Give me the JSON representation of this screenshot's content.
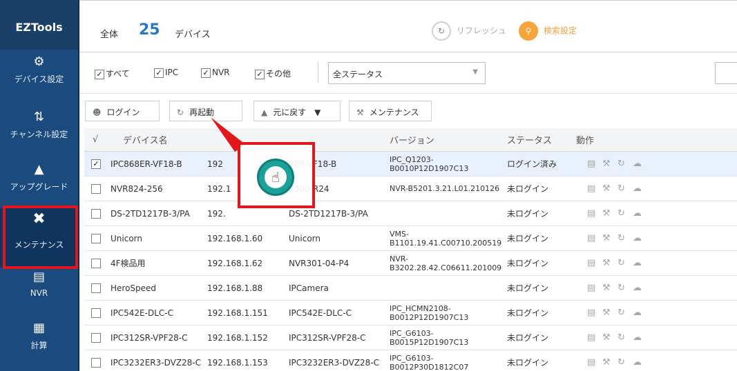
{
  "sidebar": {
    "logo": "EZTools",
    "items": [
      {
        "label": "デバイス設定",
        "icon": "gear-icon"
      },
      {
        "label": "チャンネル設定",
        "icon": "sliders-icon"
      },
      {
        "label": "アップグレード",
        "icon": "upgrade-icon"
      },
      {
        "label": "メンテナンス",
        "icon": "tools-icon"
      },
      {
        "label": "NVR",
        "icon": "nvr-icon"
      },
      {
        "label": "計算",
        "icon": "calculator-icon"
      }
    ]
  },
  "header": {
    "total_label": "全体",
    "total_count": "25",
    "total_unit": "デバイス",
    "refresh_label": "リフレッシュ",
    "search_settings_label": "検索設定"
  },
  "filters": {
    "all": "すべて",
    "ipc": "IPC",
    "nvr": "NVR",
    "other": "その他",
    "status_value": "全ステータス"
  },
  "toolbar": {
    "login": "ログイン",
    "reboot": "再起動",
    "restore": "元に戻す",
    "maintenance": "メンテナンス"
  },
  "table": {
    "headers": {
      "check": "√",
      "name": "デバイス名",
      "version": "バージョン",
      "status": "ステータス",
      "action": "動作"
    },
    "rows": [
      {
        "name": "IPC868ER-VF18-B",
        "ip": "192",
        "model": "8ER-VF18-B",
        "version": "IPC_Q1203-B0010P12D1907C13",
        "status": "ログイン済み",
        "checked": true
      },
      {
        "name": "NVR824-256",
        "ip": "192.1",
        "model": "5300-R24",
        "version": "NVR-B5201.3.21.L01.210126",
        "status": "未ログイン",
        "checked": false
      },
      {
        "name": "DS-2TD1217B-3/PA",
        "ip": "192.",
        "model": "DS-2TD1217B-3/PA",
        "version": "",
        "status": "未ログイン",
        "checked": false
      },
      {
        "name": "Unicorn",
        "ip": "192.168.1.60",
        "model": "Unicorn",
        "version": "VMS-B1101.19.41.C00710.200519",
        "status": "未ログイン",
        "checked": false
      },
      {
        "name": "4F検品用",
        "ip": "192.168.1.62",
        "model": "NVR301-04-P4",
        "version": "NVR-B3202.28.42.C06611.201009",
        "status": "未ログイン",
        "checked": false
      },
      {
        "name": "HeroSpeed",
        "ip": "192.168.1.88",
        "model": "IPCamera",
        "version": "",
        "status": "未ログイン",
        "checked": false
      },
      {
        "name": "IPC542E-DLC-C",
        "ip": "192.168.1.151",
        "model": "IPC542E-DLC-C",
        "version": "IPC_HCMN2108-B0012P12D1907C13",
        "status": "未ログイン",
        "checked": false
      },
      {
        "name": "IPC312SR-VPF28-C",
        "ip": "192.168.1.152",
        "model": "IPC312SR-VPF28-C",
        "version": "IPC_G6103-B0015P12D1907C13",
        "status": "未ログイン",
        "checked": false
      },
      {
        "name": "IPC3232ER3-DVZ28-C",
        "ip": "192.168.1.153",
        "model": "IPC3232ER3-DVZ28-C",
        "version": "IPC_G6103-B0012P30D1812C07",
        "status": "未ログイン",
        "checked": false
      }
    ]
  },
  "colors": {
    "sidebar": "#1b4a7e",
    "accent_blue": "#2a78c2",
    "highlight_red": "#e3161b",
    "hand_teal": "#1aa19a",
    "search_orange": "#f6a53b"
  }
}
